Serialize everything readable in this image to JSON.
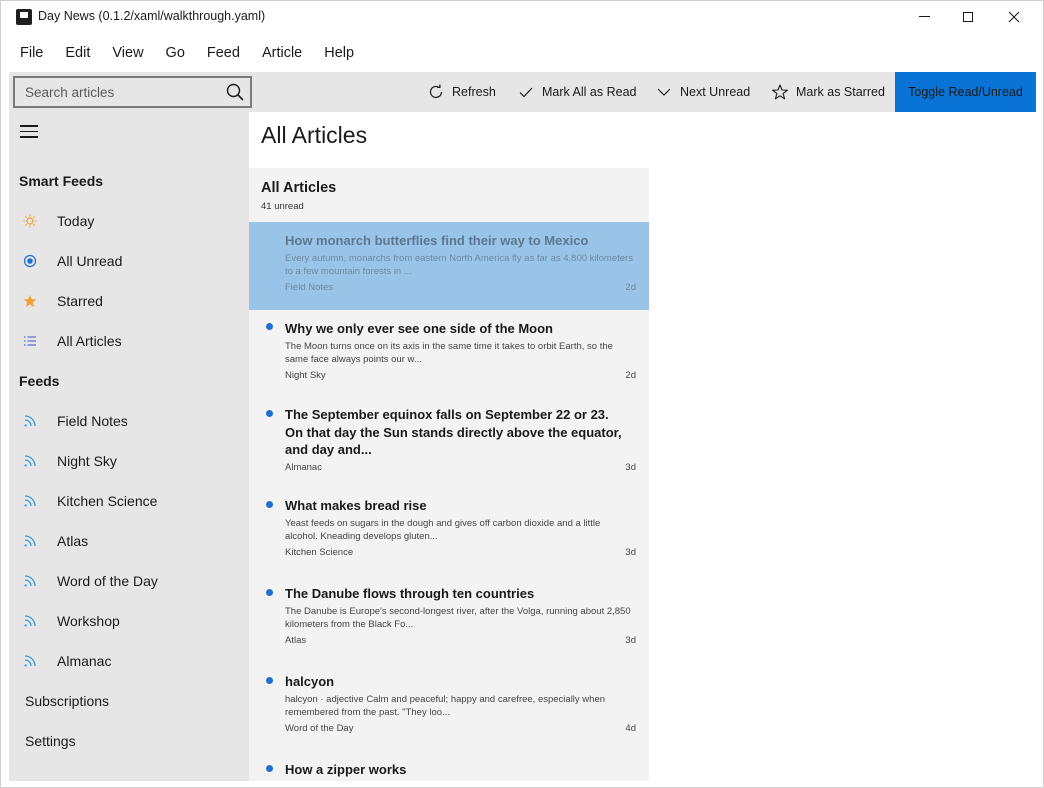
{
  "window": {
    "title": "Day News (0.1.2/xaml/walkthrough.yaml)"
  },
  "menu": [
    "File",
    "Edit",
    "View",
    "Go",
    "Feed",
    "Article",
    "Help"
  ],
  "toolbar": {
    "search_placeholder": "Search articles",
    "refresh_label": "Refresh",
    "mark_all_label": "Mark All as Read",
    "next_unread_label": "Next Unread",
    "mark_starred_label": "Mark as Starred",
    "toggle_label": "Toggle Read/Unread",
    "accent_color": "#0a74d6"
  },
  "sidebar": {
    "smart_feeds_heading": "Smart Feeds",
    "smart_feeds": [
      {
        "label": "Today",
        "icon": "sun-icon"
      },
      {
        "label": "All Unread",
        "icon": "radio-dot-icon"
      },
      {
        "label": "Starred",
        "icon": "star-icon"
      },
      {
        "label": "All Articles",
        "icon": "list-icon"
      }
    ],
    "feeds_heading": "Feeds",
    "feeds": [
      {
        "label": "Field Notes",
        "icon": "rss-icon"
      },
      {
        "label": "Night Sky",
        "icon": "rss-icon"
      },
      {
        "label": "Kitchen Science",
        "icon": "rss-icon"
      },
      {
        "label": "Atlas",
        "icon": "rss-icon"
      },
      {
        "label": "Word of the Day",
        "icon": "rss-icon"
      },
      {
        "label": "Workshop",
        "icon": "rss-icon"
      },
      {
        "label": "Almanac",
        "icon": "rss-icon"
      }
    ],
    "subscriptions_label": "Subscriptions",
    "settings_label": "Settings"
  },
  "main": {
    "page_title": "All Articles",
    "list_title": "All Articles",
    "list_subtitle": "41 unread",
    "articles": [
      {
        "title": "How monarch butterflies find their way to Mexico",
        "snippet": "Every autumn, monarchs from eastern North America fly as far as 4,800 kilometers to a few mountain forests in ...",
        "source": "Field Notes",
        "age": "2d",
        "unread": false,
        "selected": true
      },
      {
        "title": "Why we only ever see one side of the Moon",
        "snippet": "The Moon turns once on its axis in the same time it takes to orbit Earth, so the same face always points our w...",
        "source": "Night Sky",
        "age": "2d",
        "unread": true,
        "selected": false
      },
      {
        "title": "The September equinox falls on September 22 or 23. On that day the Sun stands directly above the equator, and day and...",
        "snippet": "",
        "source": "Almanac",
        "age": "3d",
        "unread": true,
        "selected": false
      },
      {
        "title": "What makes bread rise",
        "snippet": "Yeast feeds on sugars in the dough and gives off carbon dioxide and a little alcohol. Kneading develops gluten...",
        "source": "Kitchen Science",
        "age": "3d",
        "unread": true,
        "selected": false
      },
      {
        "title": "The Danube flows through ten countries",
        "snippet": "The Danube is Europe's second-longest river, after the Volga, running about 2,850 kilometers from the Black Fo...",
        "source": "Atlas",
        "age": "3d",
        "unread": true,
        "selected": false
      },
      {
        "title": "halcyon",
        "snippet": "halcyon · adjective Calm and peaceful; happy and carefree, especially when remembered from the past. \"They loo...",
        "source": "Word of the Day",
        "age": "4d",
        "unread": true,
        "selected": false
      },
      {
        "title": "How a zipper works",
        "snippet": "",
        "source": "",
        "age": "",
        "unread": true,
        "selected": false
      }
    ]
  }
}
